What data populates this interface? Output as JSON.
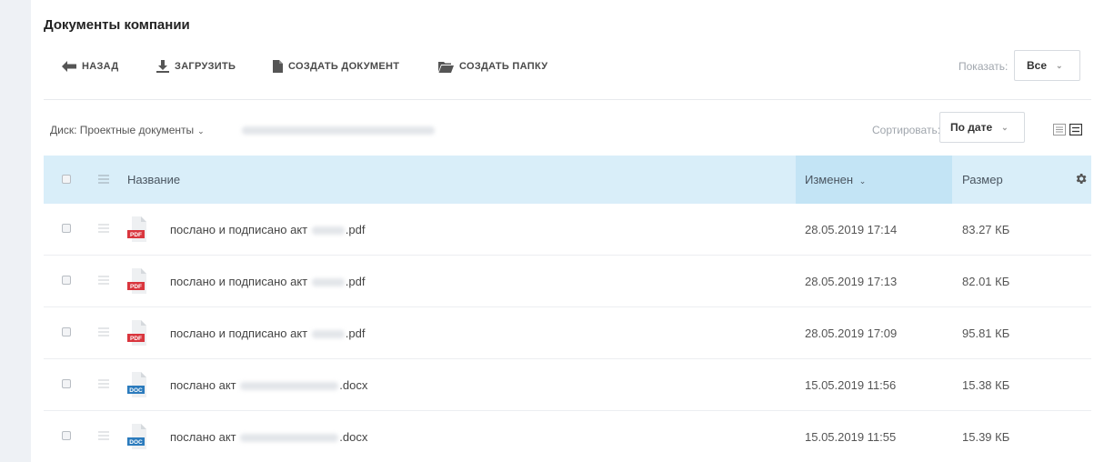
{
  "page": {
    "title": "Документы компании"
  },
  "toolbar": {
    "back_label": "НАЗАД",
    "upload_label": "ЗАГРУЗИТЬ",
    "create_document_label": "СОЗДАТЬ ДОКУМЕНТ",
    "create_folder_label": "СОЗДАТЬ ПАПКУ",
    "show_label": "Показать:",
    "show_value": "Все"
  },
  "filter_bar": {
    "disk_label": "Диск: Проектные документы",
    "sort_label": "Сортировать:",
    "sort_value": "По дате"
  },
  "table": {
    "headers": {
      "name": "Название",
      "modified": "Изменен",
      "size": "Размер"
    },
    "rows": [
      {
        "name_prefix": "послано и подписано акт",
        "name_suffix": ".pdf",
        "type": "PDF",
        "modified": "28.05.2019 17:14",
        "size": "83.27 КБ"
      },
      {
        "name_prefix": "послано и подписано акт",
        "name_suffix": ".pdf",
        "type": "PDF",
        "modified": "28.05.2019 17:13",
        "size": "82.01 КБ"
      },
      {
        "name_prefix": "послано и подписано акт",
        "name_suffix": ".pdf",
        "type": "PDF",
        "modified": "28.05.2019 17:09",
        "size": "95.81 КБ"
      },
      {
        "name_prefix": "послано акт",
        "name_suffix": ".docx",
        "type": "DOC",
        "modified": "15.05.2019 11:56",
        "size": "15.38 КБ"
      },
      {
        "name_prefix": "послано акт",
        "name_suffix": ".docx",
        "type": "DOC",
        "modified": "15.05.2019 11:55",
        "size": "15.39 КБ"
      }
    ]
  },
  "colors": {
    "header_bg": "#d9eef9",
    "header_active_bg": "#c3e4f5",
    "pdf_badge": "#d9363e",
    "doc_badge": "#2b7bbd"
  }
}
